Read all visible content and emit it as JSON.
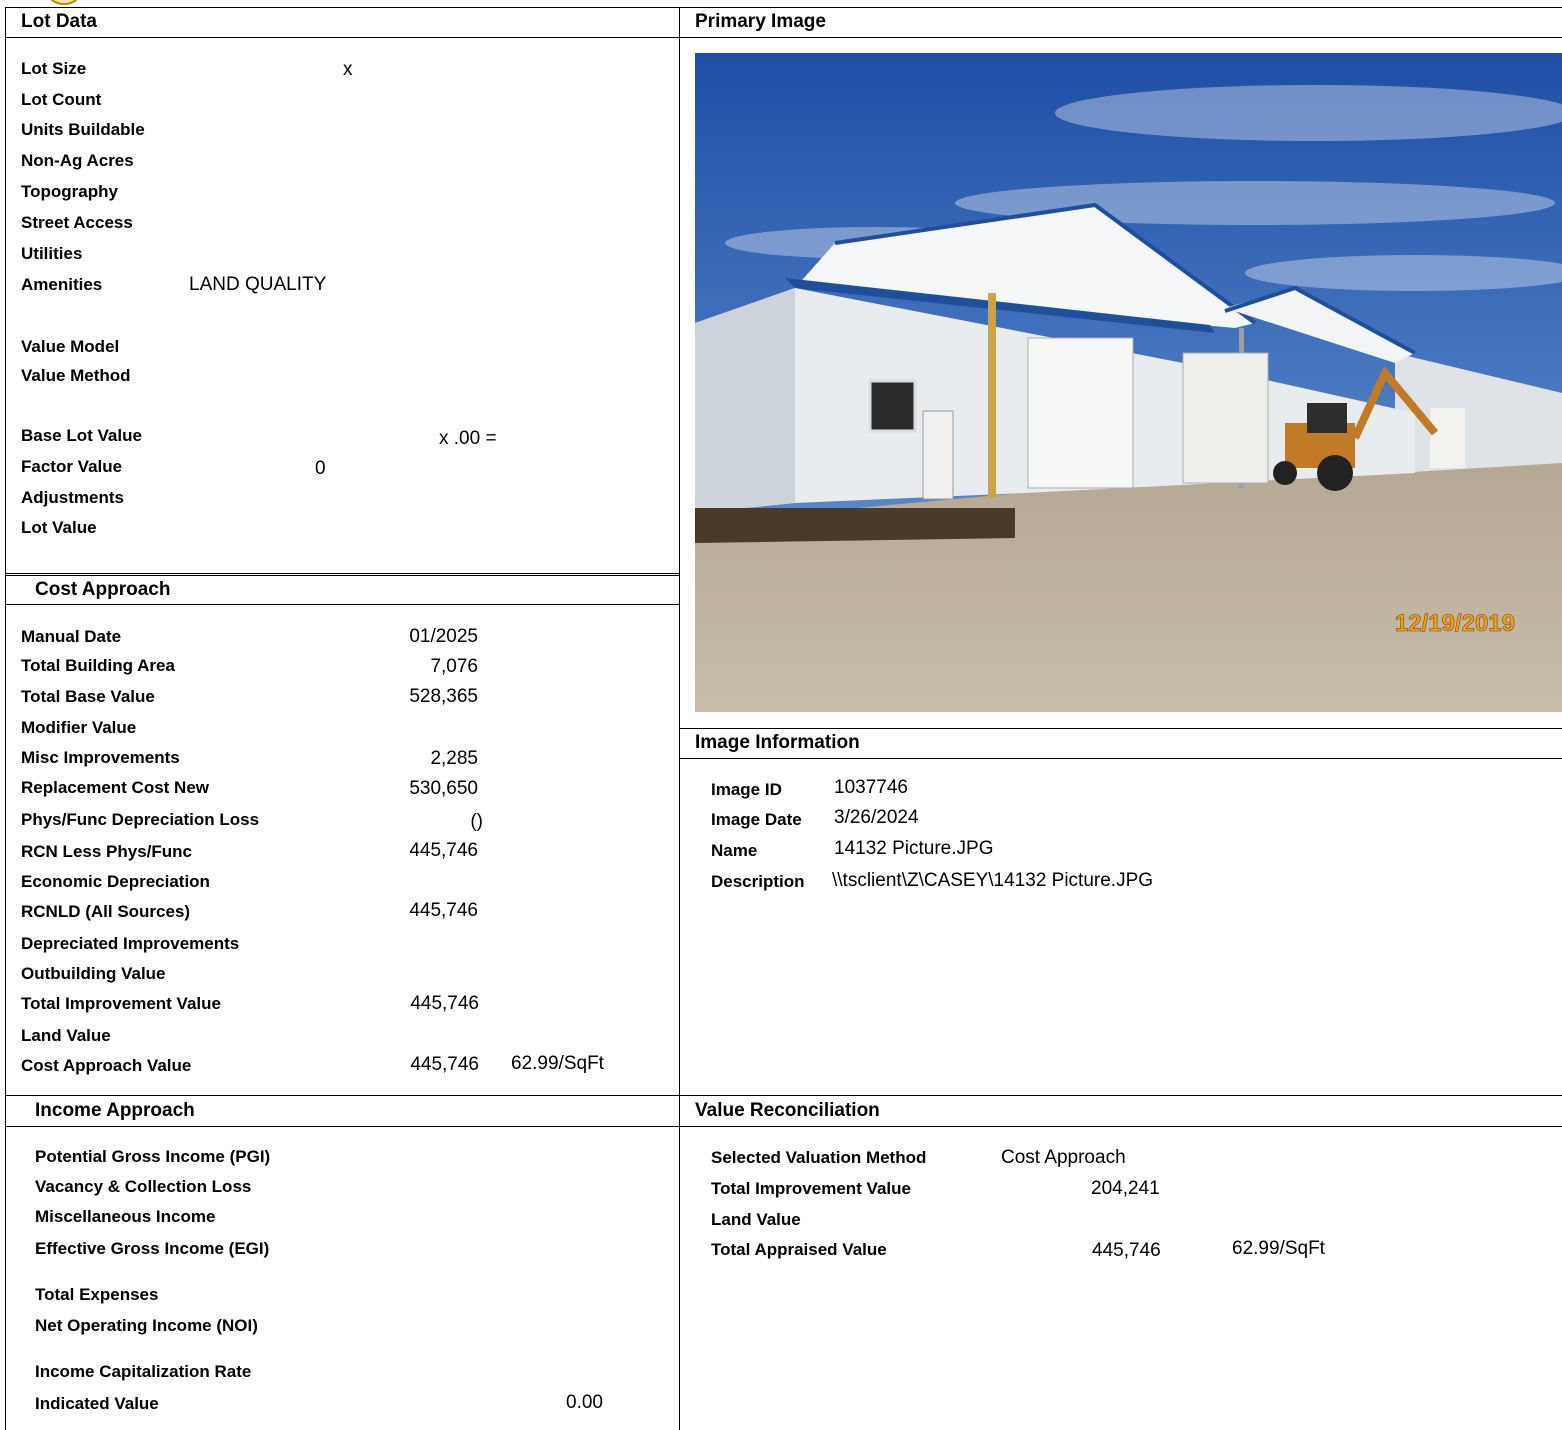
{
  "seal": {
    "icon": "seal-icon"
  },
  "lot_data": {
    "title": "Lot Data",
    "lot_size": {
      "label": "Lot Size",
      "value": "x"
    },
    "lot_count": {
      "label": "Lot Count"
    },
    "units_buildable": {
      "label": "Units Buildable"
    },
    "non_ag_acres": {
      "label": "Non-Ag Acres"
    },
    "topography": {
      "label": "Topography"
    },
    "street_access": {
      "label": "Street Access"
    },
    "utilities": {
      "label": "Utilities"
    },
    "amenities": {
      "label": "Amenities",
      "value": "LAND QUALITY"
    },
    "value_model": {
      "label": "Value Model"
    },
    "value_method": {
      "label": "Value Method"
    },
    "base_lot_value": {
      "label": "Base Lot Value",
      "value": "x .00 ="
    },
    "factor_value": {
      "label": "Factor Value",
      "value": "0"
    },
    "adjustments": {
      "label": "Adjustments"
    },
    "lot_value": {
      "label": "Lot Value"
    }
  },
  "primary_image": {
    "title": "Primary Image",
    "date_stamp": "12/19/2019"
  },
  "image_info": {
    "title": "Image Information",
    "image_id": {
      "label": "Image ID",
      "value": "1037746"
    },
    "image_date": {
      "label": "Image Date",
      "value": "3/26/2024"
    },
    "name": {
      "label": "Name",
      "value": "14132 Picture.JPG"
    },
    "description": {
      "label": "Description",
      "value": "\\\\tsclient\\Z\\CASEY\\14132 Picture.JPG"
    }
  },
  "cost_approach": {
    "title": "Cost Approach",
    "manual_date": {
      "label": "Manual Date",
      "value": "01/2025"
    },
    "total_building_area": {
      "label": "Total Building Area",
      "value": "7,076"
    },
    "total_base_value": {
      "label": "Total Base Value",
      "value": "528,365"
    },
    "modifier_value": {
      "label": "Modifier Value"
    },
    "misc_improvements": {
      "label": "Misc Improvements",
      "value": "2,285"
    },
    "replacement_cost_new": {
      "label": "Replacement Cost New",
      "value": "530,650"
    },
    "phys_func_depreciation": {
      "label": "Phys/Func Depreciation Loss",
      "value": "()"
    },
    "rcn_less_phys_func": {
      "label": "RCN Less Phys/Func",
      "value": "445,746"
    },
    "economic_depreciation": {
      "label": "Economic Depreciation"
    },
    "rcnld": {
      "label": "RCNLD (All Sources)",
      "value": "445,746"
    },
    "depreciated_improvements": {
      "label": "Depreciated Improvements"
    },
    "outbuilding_value": {
      "label": "Outbuilding Value"
    },
    "total_improvement_value": {
      "label": "Total Improvement Value",
      "value": "445,746"
    },
    "land_value": {
      "label": "Land Value"
    },
    "cost_approach_value": {
      "label": "Cost Approach Value",
      "value": "445,746",
      "per_sqft": "62.99/SqFt"
    }
  },
  "income_approach": {
    "title": "Income Approach",
    "pgi": {
      "label": "Potential Gross Income (PGI)"
    },
    "vacancy": {
      "label": "Vacancy & Collection Loss"
    },
    "misc_income": {
      "label": "Miscellaneous Income"
    },
    "egi": {
      "label": "Effective Gross Income (EGI)"
    },
    "total_expenses": {
      "label": "Total Expenses"
    },
    "noi": {
      "label": "Net Operating Income (NOI)"
    },
    "cap_rate": {
      "label": "Income Capitalization Rate"
    },
    "indicated_value": {
      "label": "Indicated Value",
      "value": "0.00"
    }
  },
  "value_reconciliation": {
    "title": "Value Reconciliation",
    "selected_method": {
      "label": "Selected Valuation Method",
      "value": "Cost Approach"
    },
    "total_improvement_value": {
      "label": "Total Improvement Value",
      "value": "204,241"
    },
    "land_value": {
      "label": "Land Value"
    },
    "total_appraised_value": {
      "label": "Total Appraised Value",
      "value": "445,746",
      "per_sqft": "62.99/SqFt"
    }
  },
  "colors": {
    "sky": "#2a5db0",
    "building": "#e9ecef",
    "trim": "#1f4f9c",
    "ground": "#b7ab9a",
    "date_stamp": "#f0a020"
  }
}
